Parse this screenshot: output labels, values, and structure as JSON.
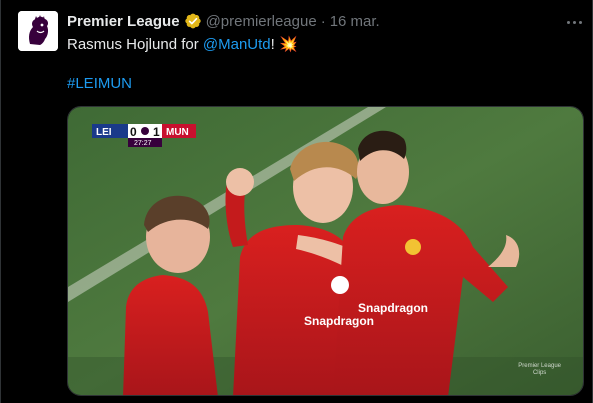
{
  "tweet": {
    "author_name": "Premier League",
    "handle": "@premierleague",
    "separator": "·",
    "date": "16 mar.",
    "text_before": "Rasmus Hojlund for ",
    "mention": "@ManUtd",
    "text_after": "! ",
    "emoji": "💥",
    "hashtag": "#LEIMUN",
    "icons": {
      "avatar": "premier-league-lion-logo",
      "verified": "verified-badge-gold",
      "more": "more-options-icon"
    },
    "colors": {
      "link": "#1d9bf0",
      "verified": "#e2b719",
      "muted": "#71767b",
      "text": "#e7e9ea",
      "background": "#000000"
    }
  },
  "media": {
    "scorebug": {
      "home_team": "LEI",
      "home_score": "0",
      "away_score": "1",
      "away_team": "MUN",
      "clock": "27:27"
    },
    "shirt_sponsor": "Snapdragon",
    "watermark_line1": "Premier League",
    "watermark_line2": "Clips"
  }
}
